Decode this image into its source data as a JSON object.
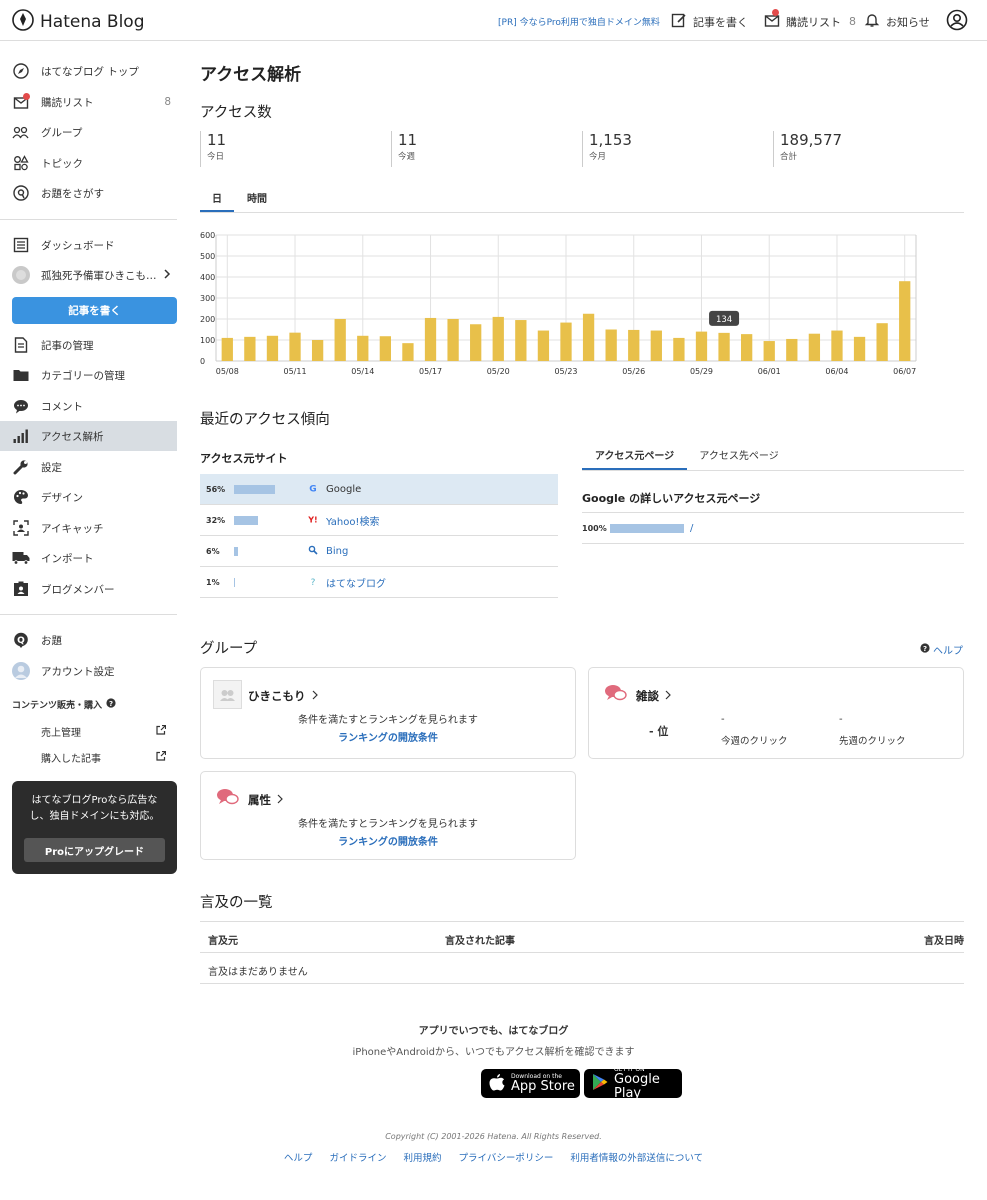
{
  "header": {
    "logo_text": "Hatena Blog",
    "pr_text": "[PR] 今ならPro利用で独自ドメイン無料",
    "write_label": "記事を書く",
    "reading_list_label": "購読リスト",
    "reading_list_count": "8",
    "notifications_label": "お知らせ"
  },
  "sidebar": {
    "top_items": [
      {
        "label": "はてなブログ トップ",
        "icon": "compass-icon"
      },
      {
        "label": "購読リスト",
        "icon": "reading-list-icon",
        "count": "8"
      },
      {
        "label": "グループ",
        "icon": "group-icon"
      },
      {
        "label": "トピック",
        "icon": "topic-icon"
      },
      {
        "label": "お題をさがす",
        "icon": "search-theme-icon"
      }
    ],
    "dashboard_label": "ダッシュボード",
    "blog_name": "孤独死予備軍ひきこも…",
    "write_button": "記事を書く",
    "blog_items": [
      {
        "label": "記事の管理",
        "icon": "document-icon"
      },
      {
        "label": "カテゴリーの管理",
        "icon": "folder-icon"
      },
      {
        "label": "コメント",
        "icon": "comment-icon"
      },
      {
        "label": "アクセス解析",
        "icon": "bar-chart-icon",
        "active": true
      },
      {
        "label": "設定",
        "icon": "wrench-icon"
      },
      {
        "label": "デザイン",
        "icon": "palette-icon"
      },
      {
        "label": "アイキャッチ",
        "icon": "eyecatch-icon"
      },
      {
        "label": "インポート",
        "icon": "truck-icon"
      },
      {
        "label": "ブログメンバー",
        "icon": "member-icon"
      }
    ],
    "theme_label": "お題",
    "account_label": "アカウント設定",
    "content_sales_label": "コンテンツ販売・購入",
    "sales_mgmt_label": "売上管理",
    "purchased_label": "購入した記事",
    "promo_text": "はてなブログProなら広告なし、独自ドメインにも対応。",
    "promo_button": "Proにアップグレード"
  },
  "main": {
    "title": "アクセス解析",
    "access_count_heading": "アクセス数",
    "stats": [
      {
        "value": "11",
        "label": "今日"
      },
      {
        "value": "11",
        "label": "今週"
      },
      {
        "value": "1,153",
        "label": "今月"
      },
      {
        "value": "189,577",
        "label": "合計"
      }
    ],
    "tabs": [
      "日",
      "時間"
    ],
    "tooltip_value": "134",
    "trend_heading": "最近のアクセス傾向",
    "source_heading": "アクセス元サイト",
    "sources": [
      {
        "pct": "56%",
        "frac": 0.56,
        "name": "Google",
        "icon": "google-icon"
      },
      {
        "pct": "32%",
        "frac": 0.32,
        "name": "Yahoo!検索",
        "icon": "yahoo-icon"
      },
      {
        "pct": "6%",
        "frac": 0.06,
        "name": "Bing",
        "icon": "bing-search-icon"
      },
      {
        "pct": "1%",
        "frac": 0.01,
        "name": "はてなブログ",
        "icon": "hatena-question-icon"
      }
    ],
    "page_tabs": [
      "アクセス元ページ",
      "アクセス先ページ"
    ],
    "detail_heading": "Google の詳しいアクセス元ページ",
    "detail_row": {
      "pct": "100%",
      "frac": 1.0,
      "path": "/"
    },
    "group_heading": "グループ",
    "help_label": "ヘルプ",
    "groups": {
      "hikikomori": {
        "title": "ひきこもり",
        "text": "条件を満たすとランキングを見られます",
        "link": "ランキングの開放条件"
      },
      "zatsudan": {
        "title": "雑談",
        "rank": "- 位",
        "this_week": "-",
        "this_week_label": "今週のクリック",
        "last_week": "-",
        "last_week_label": "先週のクリック"
      },
      "zokusei": {
        "title": "属性",
        "text": "条件を満たすとランキングを見られます",
        "link": "ランキングの開放条件"
      }
    },
    "mentions_heading": "言及の一覧",
    "mentions_columns": [
      "言及元",
      "言及された記事",
      "言及日時"
    ],
    "mentions_empty": "言及はまだありません"
  },
  "footer": {
    "app_title": "アプリでいつでも、はてなブログ",
    "app_sub": "iPhoneやAndroidから、いつでもアクセス解析を確認できます",
    "appstore_small": "Download on the",
    "appstore_big": "App Store",
    "googleplay_small": "GET IT ON",
    "googleplay_big": "Google Play",
    "copyright": "Copyright (C) 2001-2026 Hatena. All Rights Reserved.",
    "links": [
      "ヘルプ",
      "ガイドライン",
      "利用規約",
      "プライバシーポリシー",
      "利用者情報の外部送信について"
    ]
  },
  "chart_data": {
    "type": "bar",
    "categories": [
      "05/08",
      "05/09",
      "05/10",
      "05/11",
      "05/12",
      "05/13",
      "05/14",
      "05/15",
      "05/16",
      "05/17",
      "05/18",
      "05/19",
      "05/20",
      "05/21",
      "05/22",
      "05/23",
      "05/24",
      "05/25",
      "05/26",
      "05/27",
      "05/28",
      "05/29",
      "05/30",
      "05/31",
      "06/01",
      "06/02",
      "06/03",
      "06/04",
      "06/05",
      "06/06",
      "06/07"
    ],
    "tick_labels": [
      "05/08",
      "05/11",
      "05/14",
      "05/17",
      "05/20",
      "05/23",
      "05/26",
      "05/29",
      "06/01",
      "06/04",
      "06/07"
    ],
    "values": [
      110,
      115,
      120,
      135,
      100,
      200,
      120,
      118,
      85,
      205,
      200,
      175,
      210,
      195,
      145,
      183,
      225,
      150,
      148,
      145,
      110,
      140,
      134,
      128,
      95,
      105,
      130,
      145,
      115,
      180,
      380
    ],
    "ylim": [
      0,
      600
    ],
    "yticks": [
      0,
      100,
      200,
      300,
      400,
      500,
      600
    ],
    "bar_color": "#e8c04a",
    "highlight_index": 22,
    "grid": true
  }
}
